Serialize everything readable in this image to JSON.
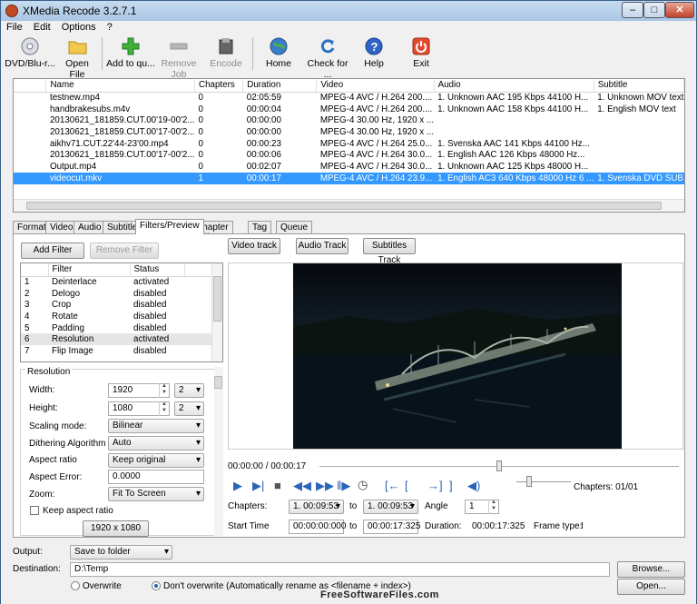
{
  "window": {
    "title": "XMedia Recode 3.2.7.1",
    "min": "–",
    "max": "□",
    "close": "✕"
  },
  "menu": [
    "File",
    "Edit",
    "Options",
    "?"
  ],
  "toolbar": {
    "dvd": "DVD/Blu-r...",
    "open": "Open File",
    "add": "Add to qu...",
    "remove": "Remove Job",
    "encode": "Encode",
    "home": "Home",
    "check": "Check for ...",
    "help": "Help",
    "exit": "Exit"
  },
  "files": {
    "headers": [
      "Name",
      "Chapters",
      "Duration",
      "Video",
      "Audio",
      "Subtitle"
    ],
    "rows": [
      [
        "testnew.mp4",
        "0",
        "02:05:59",
        "MPEG-4 AVC / H.264 200....",
        "1. Unknown AAC  195 Kbps 44100 H...",
        "1. Unknown MOV text"
      ],
      [
        "handbrakesubs.m4v",
        "0",
        "00:00:04",
        "MPEG-4 AVC / H.264 200....",
        "1. Unknown AAC  158 Kbps 44100 H...",
        "1. English MOV text"
      ],
      [
        "20130621_181859.CUT.00'19-00'2...",
        "0",
        "00:00:00",
        "MPEG-4 30.00 Hz, 1920 x ...",
        "",
        ""
      ],
      [
        "20130621_181859.CUT.00'17-00'2...",
        "0",
        "00:00:00",
        "MPEG-4 30.00 Hz, 1920 x ...",
        "",
        ""
      ],
      [
        "aikhv71.CUT.22'44-23'00.mp4",
        "0",
        "00:00:23",
        "MPEG-4 AVC / H.264 25.0...",
        "1. Svenska AAC  141 Kbps 44100 Hz...",
        ""
      ],
      [
        "20130621_181859.CUT.00'17-00'2...",
        "0",
        "00:00:06",
        "MPEG-4 AVC / H.264 30.0...",
        "1. English AAC  126 Kbps 48000 Hz...",
        ""
      ],
      [
        "Output.mp4",
        "0",
        "00:02:07",
        "MPEG-4 AVC / H.264 30.0...",
        "1. Unknown AAC  125 Kbps 48000 H...",
        ""
      ],
      [
        "videocut.mkv",
        "1",
        "00:00:17",
        "MPEG-4 AVC / H.264 23.9...",
        "1. English AC3 640 Kbps 48000 Hz 6 ...",
        "1. Svenska DVD SUB"
      ]
    ]
  },
  "tabs": [
    "Format",
    "Video",
    "Audio",
    "Subtitle",
    "Filters/Preview",
    "Chapter Editor",
    "Tag",
    "Queue"
  ],
  "filters": {
    "add": "Add Filter",
    "remove": "Remove Filter",
    "headers": [
      "Filter",
      "Status"
    ],
    "rows": [
      [
        "1",
        "Deinterlace",
        "activated"
      ],
      [
        "2",
        "Delogo",
        "disabled"
      ],
      [
        "3",
        "Crop",
        "disabled"
      ],
      [
        "4",
        "Rotate",
        "disabled"
      ],
      [
        "5",
        "Padding",
        "disabled"
      ],
      [
        "6",
        "Resolution",
        "activated"
      ],
      [
        "7",
        "Flip Image",
        "disabled"
      ]
    ]
  },
  "resolution": {
    "group": "Resolution",
    "width_label": "Width:",
    "width": "1920",
    "width_div": "2",
    "height_label": "Height:",
    "height": "1080",
    "height_div": "2",
    "scaling_label": "Scaling mode:",
    "scaling": "Bilinear",
    "dither_label": "Dithering Algorithm",
    "dither": "Auto",
    "aspect_label": "Aspect ratio",
    "aspect": "Keep original",
    "aspect_err_label": "Aspect Error:",
    "aspect_err": "0.0000",
    "zoom_label": "Zoom:",
    "zoom": "Fit To Screen",
    "keep_label": "Keep aspect ratio",
    "size_btn": "1920 x 1080"
  },
  "tracks": {
    "video": "Video track",
    "audio": "Audio Track",
    "subs": "Subtitles Track"
  },
  "preview": {
    "time": "00:00:00 / 00:00:17",
    "position": 0.5,
    "chapters": "Chapters: 01/01",
    "chapters_label": "Chapters:",
    "ch_from": "1. 00:09:53",
    "to": "to",
    "ch_to": "1. 00:09:53",
    "angle_label": "Angle",
    "angle": "1",
    "start_label": "Start Time",
    "start": "00:00:00:000",
    "to2": "to",
    "end": "00:00:17:325",
    "duration_label": "Duration:",
    "duration": "00:00:17:325",
    "frame_label": "Frame type:",
    "frame": "I"
  },
  "output": {
    "label": "Output:",
    "mode": "Save to folder",
    "dest_label": "Destination:",
    "dest": "D:\\Temp",
    "browse": "Browse...",
    "open": "Open...",
    "overwrite": "Overwrite",
    "dont": "Don't overwrite (Automatically rename as <filename + index>)"
  },
  "watermark": "FreeSoftwareFiles.com",
  "colors": {
    "selection": "#3399ff",
    "titlebar": "#a9c6e4"
  }
}
